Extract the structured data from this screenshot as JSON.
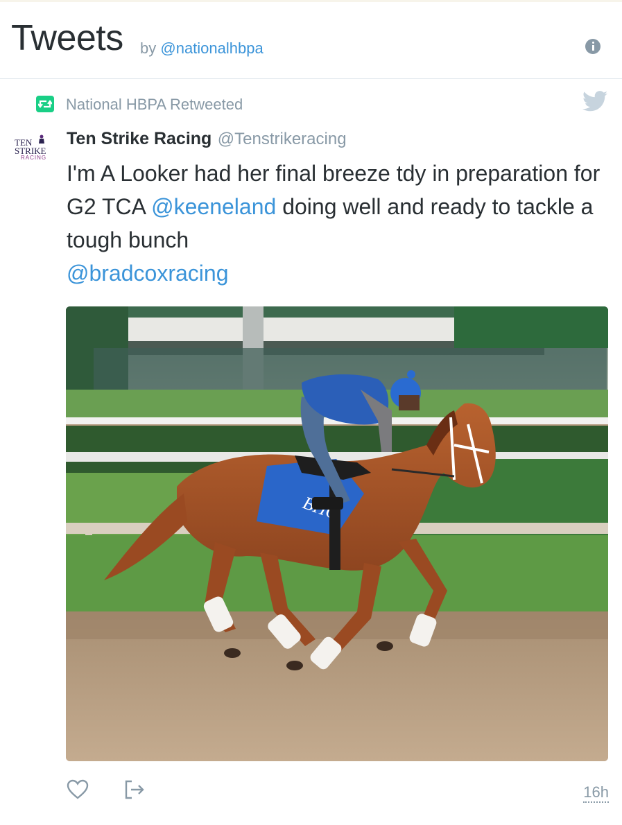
{
  "header": {
    "title": "Tweets",
    "by_label": "by",
    "handle": "@nationalhbpa",
    "info_icon": "info-icon"
  },
  "retweet": {
    "icon": "retweet-icon",
    "label": "National HBPA Retweeted",
    "brand_icon": "twitter-bird-icon",
    "accent_color": "#19cf86"
  },
  "tweet": {
    "avatar": {
      "line1": "TEN",
      "line2": "STRIKE",
      "line3": "RACING"
    },
    "author_name": "Ten Strike Racing",
    "author_handle": "@Tenstrikeracing",
    "text_segments": [
      {
        "text": "I'm A Looker had her final breeze tdy in preparation for G2 TCA ",
        "type": "text"
      },
      {
        "text": "@keeneland",
        "type": "mention"
      },
      {
        "text": " doing well and ready to tackle a tough bunch ",
        "type": "text"
      },
      {
        "text": "@bradcoxracing",
        "type": "mention"
      }
    ],
    "media": {
      "saddle_cloth_text": "BHC"
    },
    "actions": {
      "like_icon": "heart-icon",
      "share_icon": "share-icon"
    },
    "timestamp": "16h"
  },
  "colors": {
    "text": "#292f33",
    "muted": "#8899a6",
    "link": "#3b94d9"
  }
}
